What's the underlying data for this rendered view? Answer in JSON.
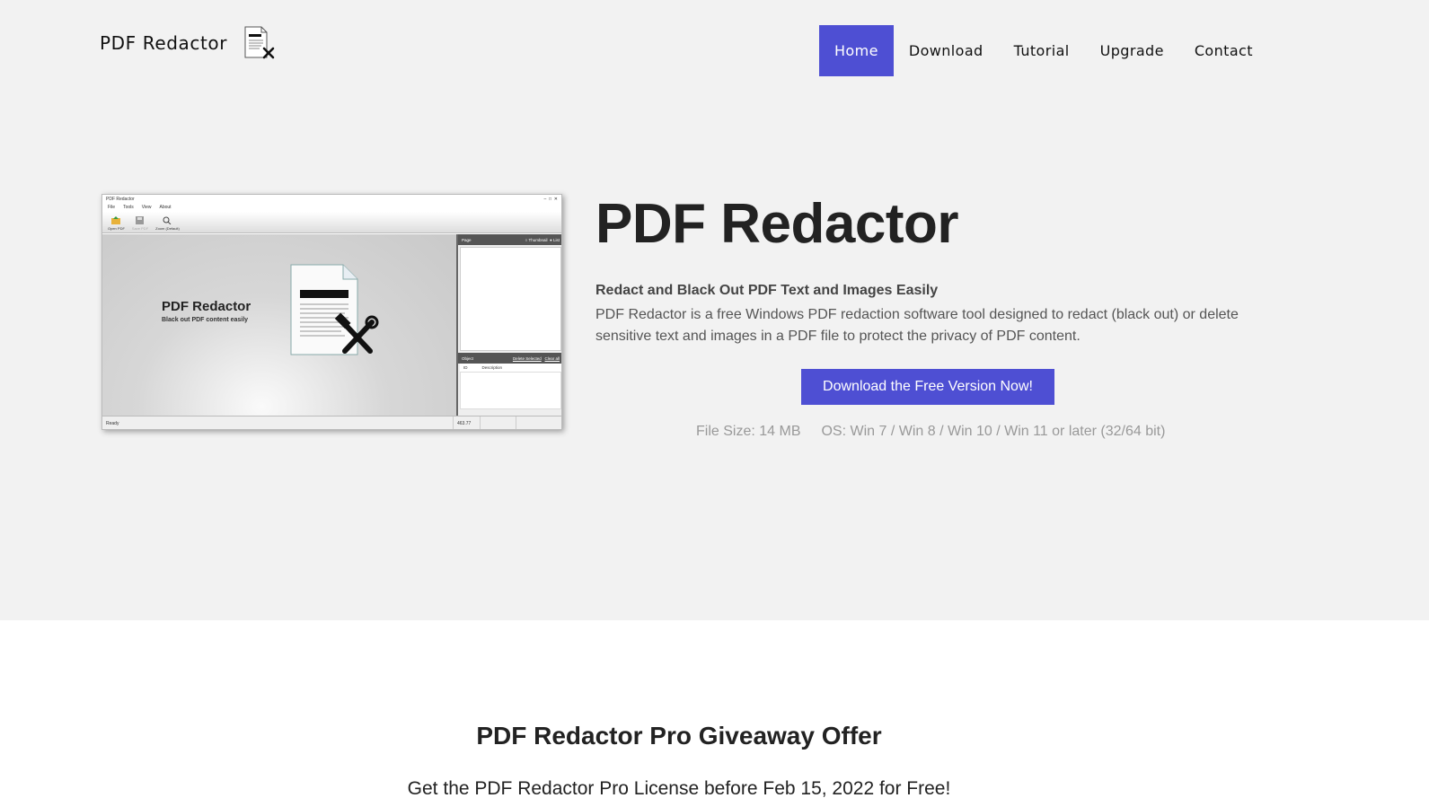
{
  "header": {
    "brand": "PDF Redactor",
    "nav": [
      "Home",
      "Download",
      "Tutorial",
      "Upgrade",
      "Contact"
    ],
    "active_nav": "Home"
  },
  "hero": {
    "title": "PDF Redactor",
    "subtitle": "Redact and Black Out PDF Text and Images Easily",
    "description": "PDF Redactor is a free Windows PDF redaction software tool designed to redact (black out) or delete sensitive text and images in a PDF file to protect the privacy of PDF content.",
    "cta_label": "Download the Free Version Now!",
    "file_size": "File Size: 14 MB",
    "os": "OS: Win 7 / Win 8 / Win 10 / Win 11 or later (32/64 bit)"
  },
  "screenshot": {
    "window_title": "PDF Redactor",
    "menu": [
      "File",
      "Tools",
      "View",
      "About"
    ],
    "toolbar": [
      "Open PDF",
      "Save PDF",
      "Zoom (Default)"
    ],
    "canvas_title": "PDF Redactor",
    "canvas_subtitle": "Black out PDF content easily",
    "page_panel_label": "Page",
    "page_panel_options": [
      "Thumbnail",
      "List"
    ],
    "object_panel_label": "Object",
    "object_panel_actions": [
      "Delete Selected",
      "Clear all"
    ],
    "object_columns": [
      "ID",
      "Description"
    ],
    "status_left": "Ready",
    "status_right": "463.77"
  },
  "offer": {
    "title": "PDF Redactor Pro Giveaway Offer",
    "text": "Get the PDF Redactor Pro License before Feb 15, 2022 for Free!"
  },
  "colors": {
    "accent": "#4e4fd3",
    "page_bg": "#f2f2f2"
  },
  "icons": {
    "brand": "document-tools-icon",
    "tools": "hammer-wrench-icon"
  }
}
